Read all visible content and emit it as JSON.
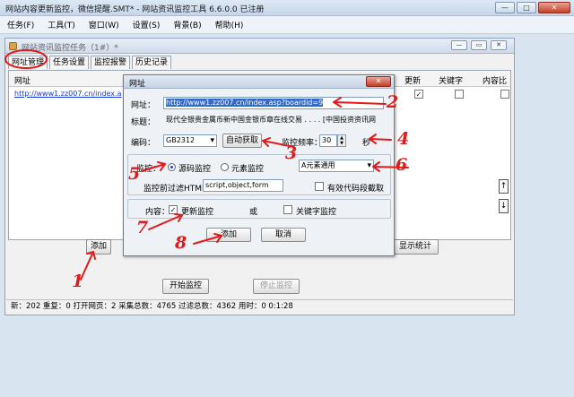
{
  "window": {
    "title": "网站内容更新监控，微信提醒.SMT* - 网站资讯监控工具 6.6.0.0  已注册",
    "minimize": "—",
    "maximize": "□",
    "close": "✕"
  },
  "menubar": {
    "items": [
      "任务(F)",
      "工具(T)",
      "窗口(W)",
      "设置(S)",
      "背景(B)",
      "帮助(H)"
    ]
  },
  "child_window": {
    "title": "网站资讯监控任务（1#）*",
    "tabs": [
      "网址管理",
      "任务设置",
      "监控报警",
      "历史记录"
    ],
    "columns": {
      "url": "网址",
      "update": "更新",
      "keyword": "关键字",
      "content_compare": "内容比"
    },
    "row": {
      "url": "http://www1.zz007.cn/index.a"
    },
    "buttons": {
      "add": "添加",
      "show_stats": "显示统计",
      "start": "开始监控",
      "stop": "停止监控"
    },
    "status": "新：202  重复：0  打开网页：2  采集总数：4765  过滤总数：4362  用时：0  0:1:28"
  },
  "dialog": {
    "title": "网址",
    "close": "✕",
    "url_label": "网址：",
    "url_value": "http://www1.zz007.cn/index.asp?boardid=9",
    "title_label": "标题：",
    "title_value": "现代全银贵金属币新中国金银币章在线交易 . . . . [中国投资资讯网",
    "encoding_label": "编码：",
    "encoding_value": "GB2312",
    "auto_fetch": "自动获取",
    "freq_label": "监控频率：",
    "freq_value": "30",
    "freq_unit": "秒",
    "monitor_label": "监控：",
    "radio_source": "源码监控",
    "radio_element": "元素监控",
    "element_select": "A元素通用",
    "filter_label": "监控前过滤HTML",
    "filter_value": "script,object,form",
    "valid_code_label": "有效代码段截取",
    "content_label": "内容：",
    "update_monitor": "更新监控",
    "or": "或",
    "keyword_monitor": "关键字监控",
    "add_button": "添加",
    "cancel_button": "取消"
  },
  "annotations": [
    "1",
    "2",
    "3",
    "4",
    "5",
    "6",
    "7",
    "8"
  ],
  "colors": {
    "annotation": "#e01b1b",
    "link": "#1a3bd0"
  }
}
